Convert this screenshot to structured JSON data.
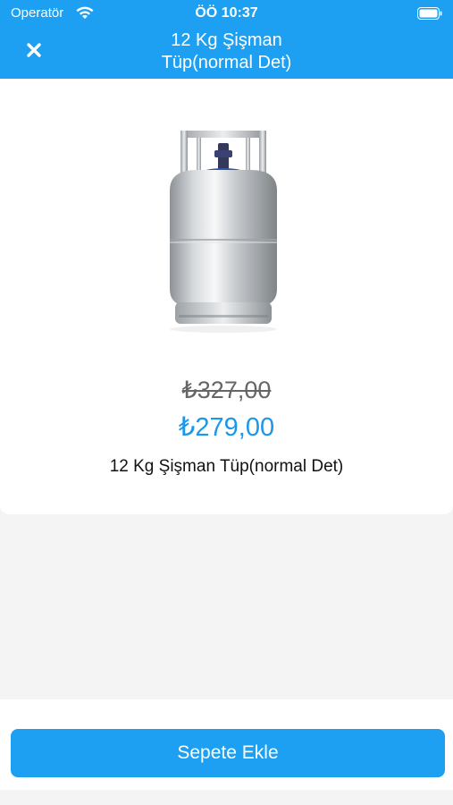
{
  "status_bar": {
    "carrier": "Operatör",
    "time": "ÖÖ 10:37"
  },
  "header": {
    "title_line1": "12 Kg Şişman",
    "title_line2": "Tüp(normal Det)",
    "close_icon": "close-icon"
  },
  "product": {
    "old_price": "₺327,00",
    "new_price": "₺279,00",
    "name": "12 Kg Şişman Tüp(normal Det)"
  },
  "actions": {
    "add_to_cart_label": "Sepete Ekle"
  },
  "colors": {
    "brand": "#1da0f2",
    "price": "#1d97e8"
  }
}
